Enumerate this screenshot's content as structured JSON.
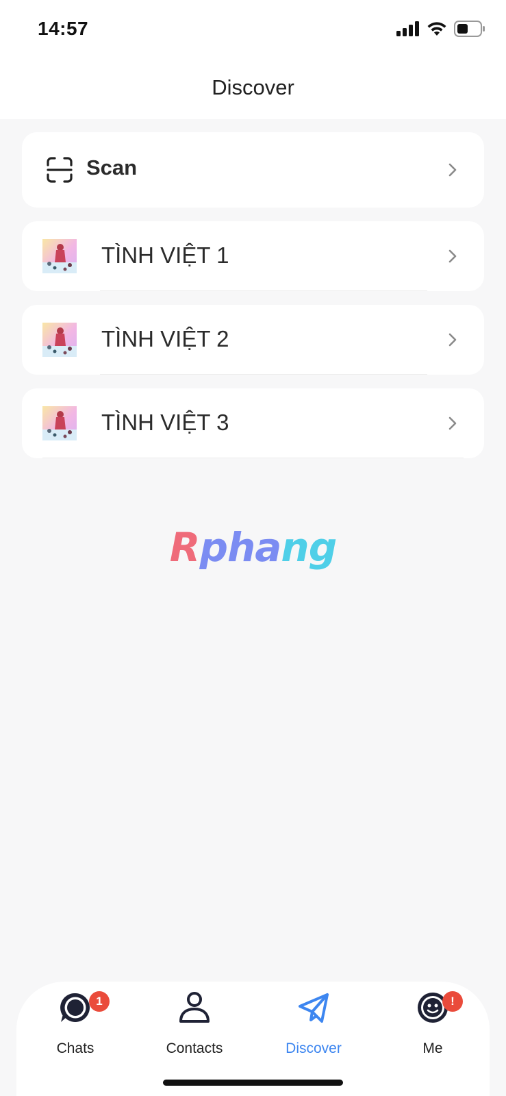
{
  "status_bar": {
    "time": "14:57",
    "icons": [
      "signal-icon",
      "wifi-icon",
      "battery-icon"
    ]
  },
  "header": {
    "title": "Discover"
  },
  "scan": {
    "icon": "scan-icon",
    "label": "Scan"
  },
  "items": [
    {
      "label": "TÌNH VIỆT 1",
      "icon": "app-thumbnail"
    },
    {
      "label": "TÌNH VIỆT 2",
      "icon": "app-thumbnail"
    },
    {
      "label": "TÌNH VIỆT 3",
      "icon": "app-thumbnail"
    }
  ],
  "watermark": {
    "part1": "R",
    "part2": "pha",
    "part3": "ng"
  },
  "tabs": [
    {
      "label": "Chats",
      "icon": "chat-bubble-icon",
      "badge": "1"
    },
    {
      "label": "Contacts",
      "icon": "person-icon",
      "badge": ""
    },
    {
      "label": "Discover",
      "icon": "paper-plane-icon",
      "badge": ""
    },
    {
      "label": "Me",
      "icon": "avatar-face-icon",
      "badge": "!"
    }
  ],
  "colors": {
    "active_tab": "#3d86f0",
    "badge": "#ea4b3b",
    "background": "#f7f7f8"
  },
  "active_tab": "Discover"
}
